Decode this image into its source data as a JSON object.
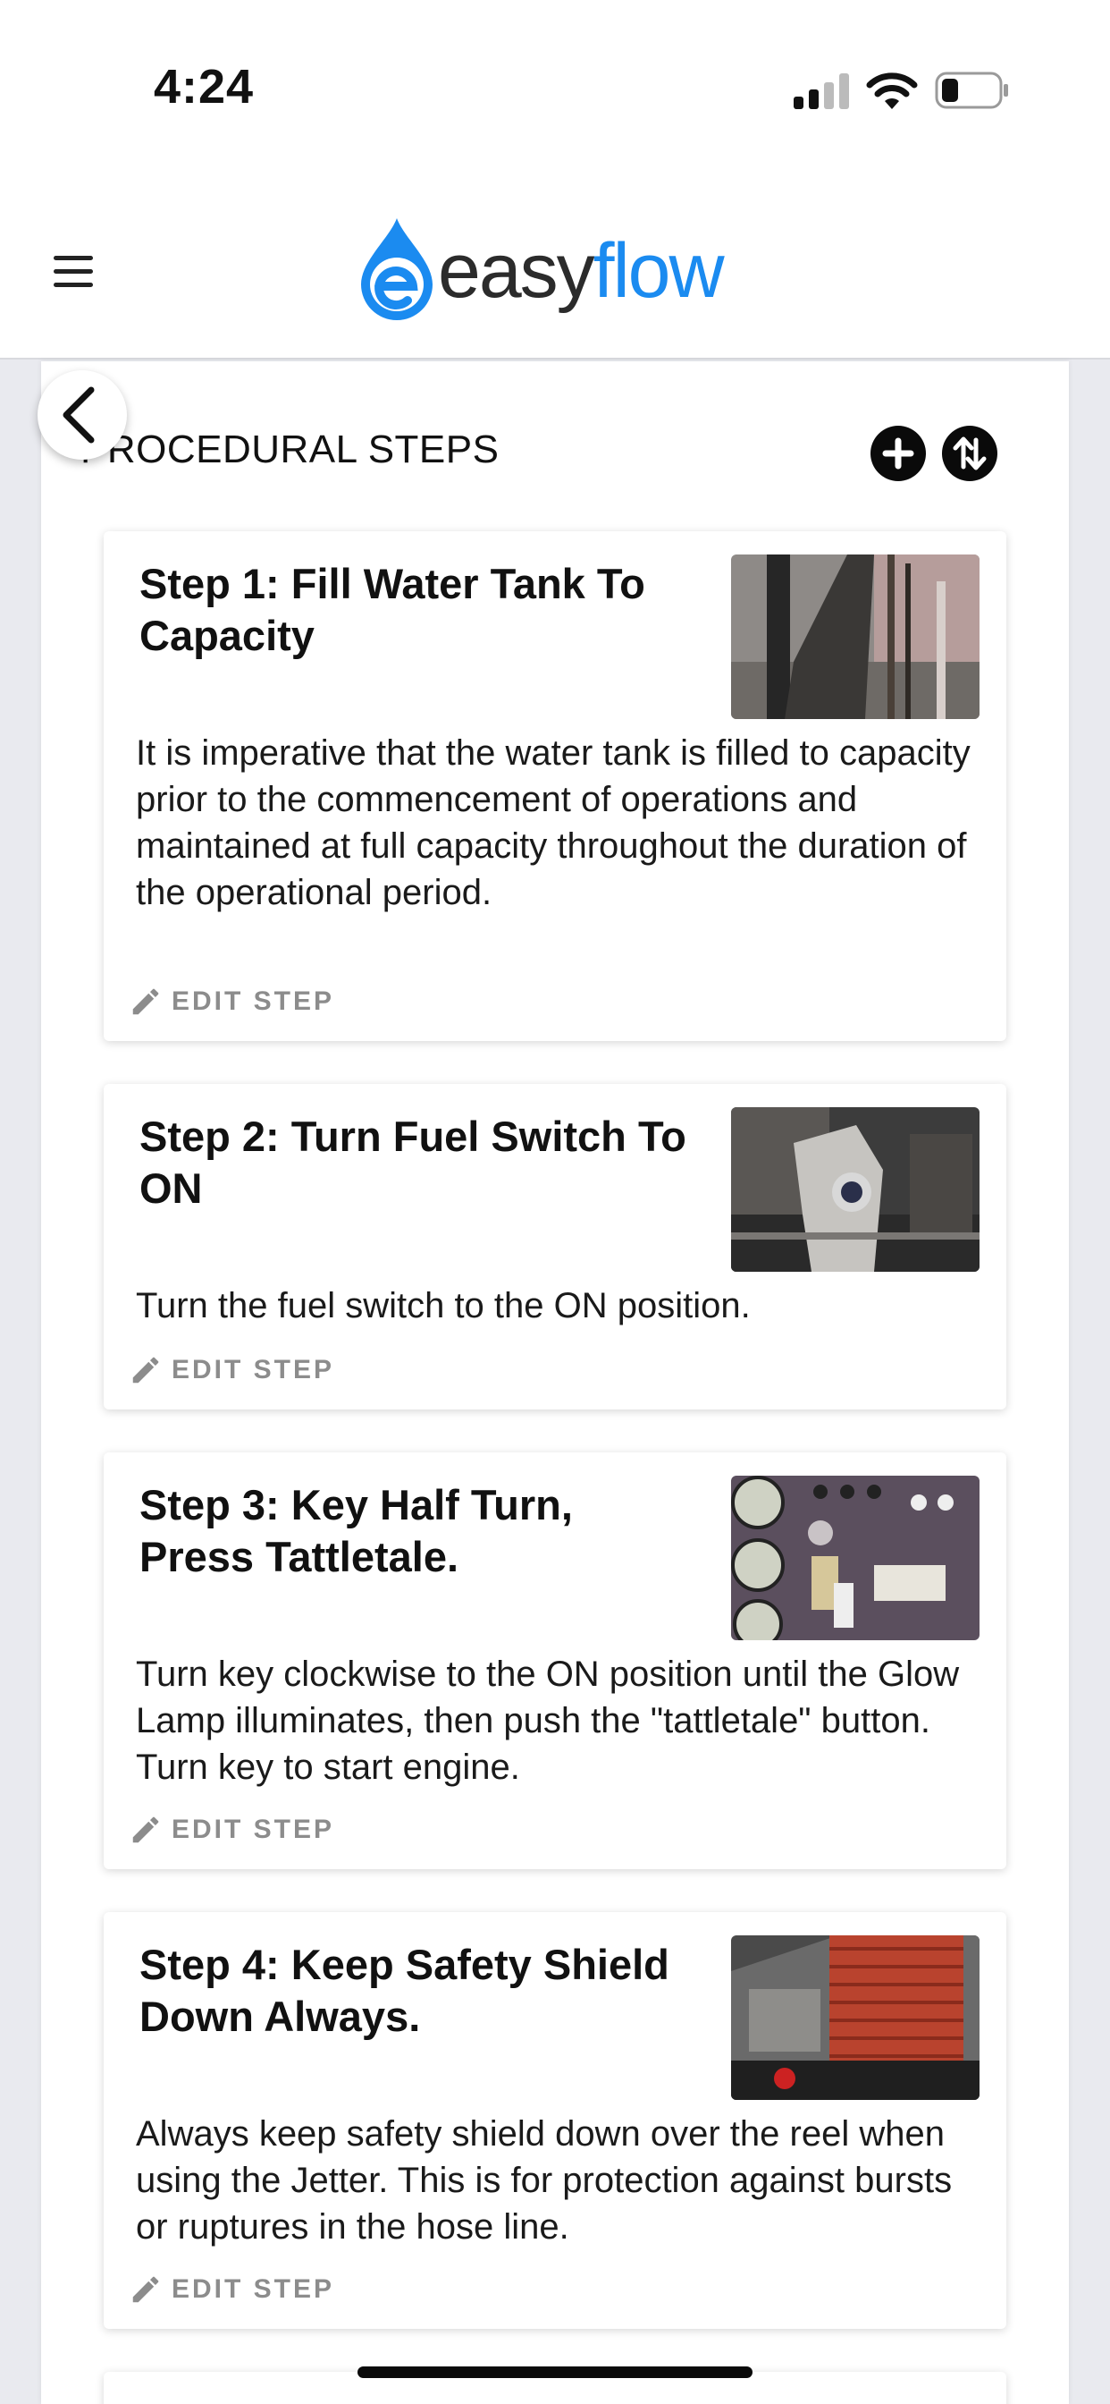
{
  "status_bar": {
    "time": "4:24"
  },
  "header": {
    "logo_easy": "easy",
    "logo_flow": "flow",
    "brand_color": "#1b8bf0"
  },
  "page": {
    "section_title": "PROCEDURAL STEPS"
  },
  "steps": [
    {
      "title": "Step 1: Fill Water Tank To Capacity",
      "description": "It is imperative that the water tank is filled to capacity prior to the commencement of operations and maintained at full capacity throughout the duration of the operational period.",
      "edit_label": "EDIT STEP"
    },
    {
      "title": "Step 2: Turn Fuel Switch To ON",
      "description": "Turn the fuel switch to the ON position.",
      "edit_label": "EDIT STEP"
    },
    {
      "title": "Step 3: Key Half Turn, Press Tattletale.",
      "description": "Turn key clockwise to the ON position until the Glow Lamp illuminates, then push the \"tattletale\" button. Turn key to start engine.",
      "edit_label": "EDIT STEP"
    },
    {
      "title": "Step 4: Keep Safety Shield Down Always.",
      "description": "Always keep safety shield down over the reel when using the Jetter. This is for protection against bursts or ruptures in the hose line.",
      "edit_label": "EDIT STEP"
    }
  ]
}
